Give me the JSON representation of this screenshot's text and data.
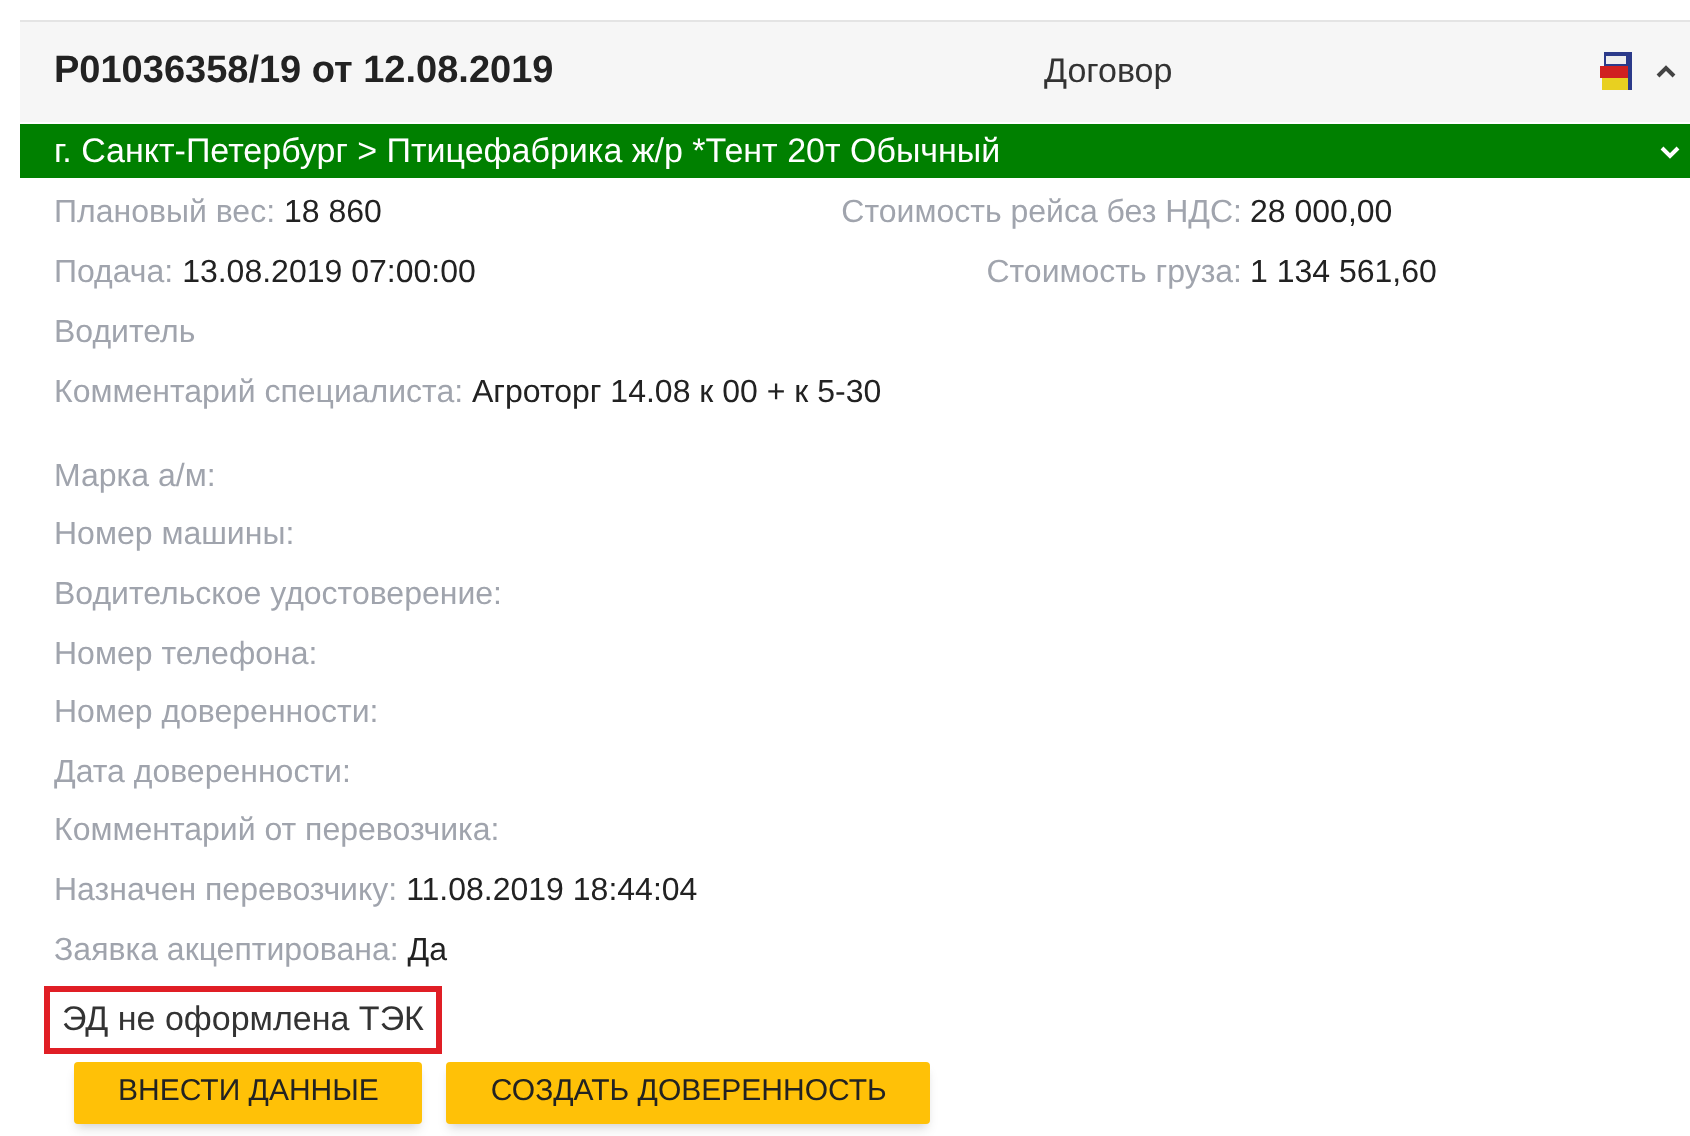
{
  "header": {
    "title": "Р01036358/19 от 12.08.2019",
    "doc_type": "Договор"
  },
  "route": "г. Санкт-Петербург > Птицефабрика ж/р *Тент 20т Обычный",
  "summary": [
    {
      "left": {
        "label": "Плановый вес:",
        "value": "18 860"
      },
      "right": {
        "label": "Стоимость рейса без НДС:",
        "value": "28 000,00"
      }
    },
    {
      "left": {
        "label": "Подача:",
        "value": "13.08.2019 07:00:00"
      },
      "right": {
        "label": "Стоимость груза:",
        "value": "1 134 561,60"
      }
    }
  ],
  "driver_fields": [
    {
      "label": "Водитель"
    },
    {
      "label": "Комментарий специалиста:",
      "value": "Агроторг 14.08 к 00 + к 5-30"
    }
  ],
  "vehicle_fields": [
    {
      "label": "Марка а/м:"
    },
    {
      "label": "Номер машины:"
    },
    {
      "label": "Водительское удостоверение:"
    },
    {
      "label": "Номер телефона:"
    },
    {
      "label": "Номер доверенности:"
    },
    {
      "label": "Дата доверенности:"
    },
    {
      "label": "Комментарий от перевозчика:"
    },
    {
      "label": "Назначен перевозчику:",
      "value": "11.08.2019 18:44:04"
    },
    {
      "label": "Заявка акцептирована:",
      "value": "Да"
    }
  ],
  "status_note": {
    "text": "ЭД не оформлена ТЭК",
    "highlighted": true
  },
  "buttons": [
    "ВНЕСТИ ДАННЫЕ",
    "СОЗДАТЬ ДОВЕРЕННОСТЬ"
  ]
}
